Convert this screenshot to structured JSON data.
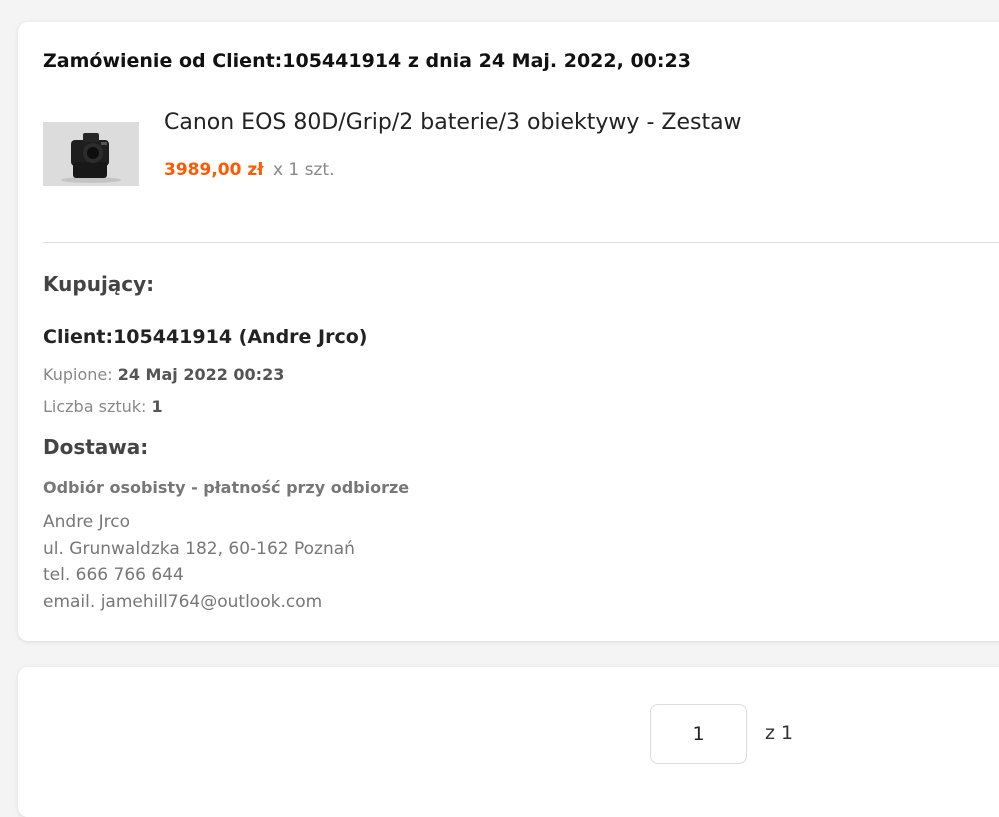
{
  "order": {
    "title": "Zamówienie od Client:105441914 z dnia 24 Maj. 2022, 00:23",
    "product": {
      "name": "Canon EOS 80D/Grip/2 baterie/3 obiektywy - Zestaw",
      "price": "3989,00 zł",
      "quantity_suffix": "x 1 szt.",
      "thumbnail_icon": "camera-thumbnail"
    }
  },
  "buyer": {
    "heading": "Kupujący:",
    "name": "Client:105441914 (Andre Jrco)",
    "bought_label": "Kupione:",
    "bought_value": "24 Maj 2022 00:23",
    "count_label": "Liczba sztuk:",
    "count_value": "1"
  },
  "delivery": {
    "heading": "Dostawa:",
    "method": "Odbiór osobisty - płatność przy odbiorze",
    "address": {
      "name": "Andre Jrco",
      "street": "ul. Grunwaldzka 182, 60-162 Poznań",
      "phone": "tel. 666 766 644",
      "email": "email. jamehill764@outlook.com"
    }
  },
  "pagination": {
    "current_page": "1",
    "total_label": "z 1"
  },
  "colors": {
    "price": "#ff5a00",
    "background": "#f4f4f4",
    "card": "#ffffff"
  }
}
